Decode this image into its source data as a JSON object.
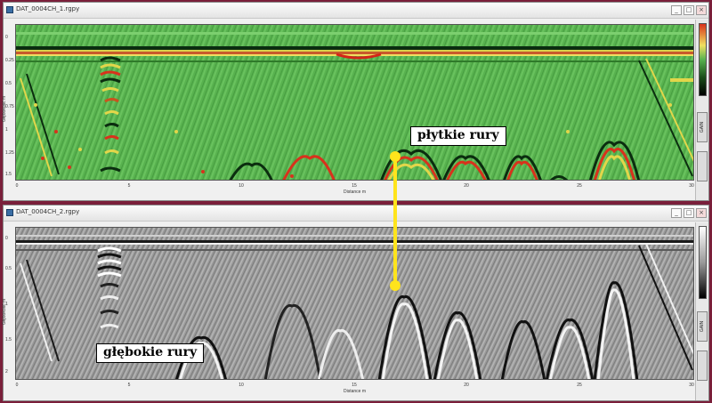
{
  "windows": [
    {
      "title": "DAT_0004CH_1.rgpy",
      "mode": "color",
      "yaxis_label": "Głębokość m",
      "yticks": [
        "0",
        "0.25",
        "0.5",
        "0.75",
        "1",
        "1.25",
        "1.5"
      ],
      "xticks": [
        "0",
        "5",
        "10",
        "15",
        "20",
        "25",
        "30"
      ],
      "xlabel": "Distance m",
      "side_tabs": [
        "GAIN",
        ""
      ]
    },
    {
      "title": "DAT_0004CH_2.rgpy",
      "mode": "gray",
      "yaxis_label": "Głębokość m",
      "yticks": [
        "0",
        "0.5",
        "1",
        "1.5",
        "2"
      ],
      "xticks": [
        "0",
        "5",
        "10",
        "15",
        "20",
        "25",
        "30"
      ],
      "xlabel": "Distance m",
      "side_tabs": [
        "GAIN",
        ""
      ]
    }
  ],
  "titlebar_buttons": [
    "_",
    "□",
    "×"
  ],
  "annotations": {
    "shallow": "płytkie rury",
    "deep": "głębokie rury"
  },
  "colors": {
    "frame": "#7a1f3a",
    "highlight": "#ffe41c",
    "radar_green": "#57b04e",
    "radar_gray": "#9a9a9a"
  }
}
